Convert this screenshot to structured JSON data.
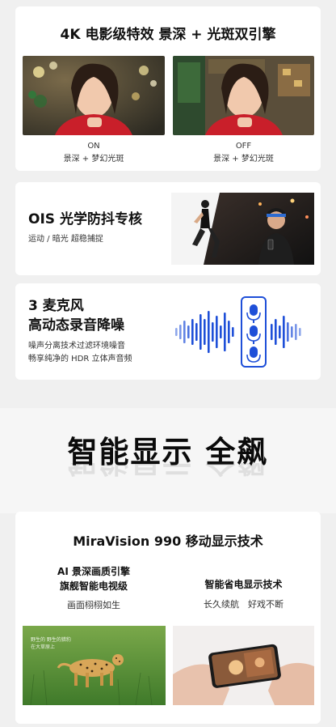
{
  "section1": {
    "title": "4K 电影级特效 景深 + 光斑双引擎",
    "on_label": "ON",
    "on_desc": "景深 + 梦幻光斑",
    "off_label": "OFF",
    "off_desc": "景深 + 梦幻光斑"
  },
  "section2": {
    "title": "OIS 光学防抖专核",
    "subtitle": "运动 / 暗光 超稳捕捉"
  },
  "section3": {
    "title_line1": "3 麦克风",
    "title_line2": "高动态录音降噪",
    "desc_line1": "噪声分离技术过滤环境噪音",
    "desc_line2": "畅享纯净的 HDR 立体声音频"
  },
  "display_heading": "智能显示 全飙",
  "section4": {
    "title": "MiraVision 990 移动显示技术",
    "left_head_line1": "AI 景深画质引擎",
    "left_head_line2": "旗舰智能电视级",
    "left_note": "画面栩栩如生",
    "right_head": "智能省电显示技术",
    "right_note": "长久续航　好戏不断",
    "overlay_line1": "野生的 野生的猎豹",
    "overlay_line2": "在大草原上"
  },
  "colors": {
    "accent_blue": "#1e4fd8",
    "card_bg": "#ffffff",
    "page_bg": "#f0f0f0"
  }
}
